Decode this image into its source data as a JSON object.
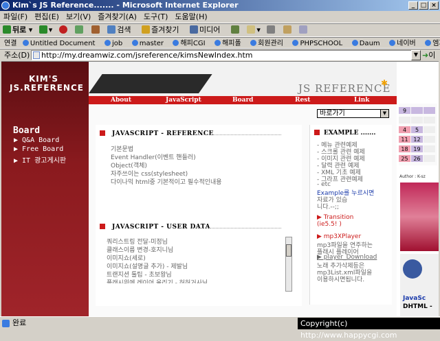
{
  "window": {
    "title": "Kim`s JS Reference....... - Microsoft Internet Explorer"
  },
  "menu": [
    "파일(F)",
    "편집(E)",
    "보기(V)",
    "즐겨찾기(A)",
    "도구(T)",
    "도움말(H)"
  ],
  "toolbar": {
    "back": "뒤로",
    "search": "검색",
    "favorites": "즐겨찾기",
    "media": "미디어"
  },
  "links": {
    "label": "연결",
    "items": [
      "Untitled Document",
      "job",
      "master",
      "해피CGI",
      "해피폴",
      "회원관리",
      "PHPSCHOOL",
      "Daum",
      "네이버",
      "엠파스"
    ]
  },
  "address": {
    "label": "주소(D)",
    "url": "http://my.dreamwiz.com/jsreference/kimsNewIndex.htm",
    "go": "이동"
  },
  "page": {
    "logo_line1": "KIM'S",
    "logo_line2": "JS.REFERENCE",
    "header_title": "JS REFERENCE",
    "nav": [
      "About",
      "JavaScript",
      "Board",
      "Rest",
      "Link"
    ],
    "quick_select": "바로가기",
    "board": {
      "heading": "Board",
      "items": [
        "▶ Q&A Board",
        "▶ Free Board",
        "▶ IT 광고게시판"
      ]
    },
    "reference": {
      "heading": "JAVASCRIPT - REFERENCE",
      "items": [
        "기본문법",
        "Event Handler(이벤트 핸들러)",
        "Object(객체)",
        "자주쓰이는 css(stylesheet)",
        "다이나믹 html중 기본적이고 필수적인내용"
      ]
    },
    "userdata": {
      "heading": "JAVASCRIPT - USER DATA",
      "items": [
        "쿼리스트링 전달-미정님",
        "클래스이름 변경-호지니님",
        "이미지쇼(세로)",
        "이미지쇼(설명글 추가) - 제발님",
        "트랜지션 툴팁 - 초보왕님",
        "플래시위에 레이어 올리기 - 허허거사님"
      ]
    },
    "example": {
      "heading": "EXAMPLE .......",
      "items": [
        "- 메뉴 관련예제",
        "- 스크롤 관련 예제",
        "- 이미지 관련 예제",
        "- 달력 관련 예제",
        "- XML 기초 예제",
        "- 그라프 관련예제",
        "- etc"
      ],
      "note_line1": "Example를 누르시면",
      "note_line2": "자료가 있습",
      "note_line3": "니다.--;;",
      "transition": "▶ Transition",
      "transition_sub": "(ie5.5! )",
      "mp3": "▶ mp3XPlayer",
      "mp3_desc1": "mp3파일을 연주하는",
      "mp3_desc2": "플래시 플레이어",
      "download": "▶ player_Download",
      "dl_desc1": "노래 추가삭제등은",
      "dl_desc2": "mp3List.xml파일을",
      "dl_desc3": "이용하시면됩니다."
    },
    "calendar": {
      "rows": [
        [
          "9",
          "",
          ""
        ],
        [
          "",
          "",
          ""
        ],
        [
          "4",
          "5",
          ""
        ],
        [
          "11",
          "12",
          ""
        ],
        [
          "18",
          "19",
          ""
        ],
        [
          "25",
          "26",
          ""
        ]
      ]
    },
    "author": "Author : K-sz",
    "ad_blue_text1": "JavaSc",
    "ad_blue_text2": "DHTML -"
  },
  "status": {
    "text": "완료",
    "copyright": "Copyright(c) http://www.happycgi.com"
  }
}
